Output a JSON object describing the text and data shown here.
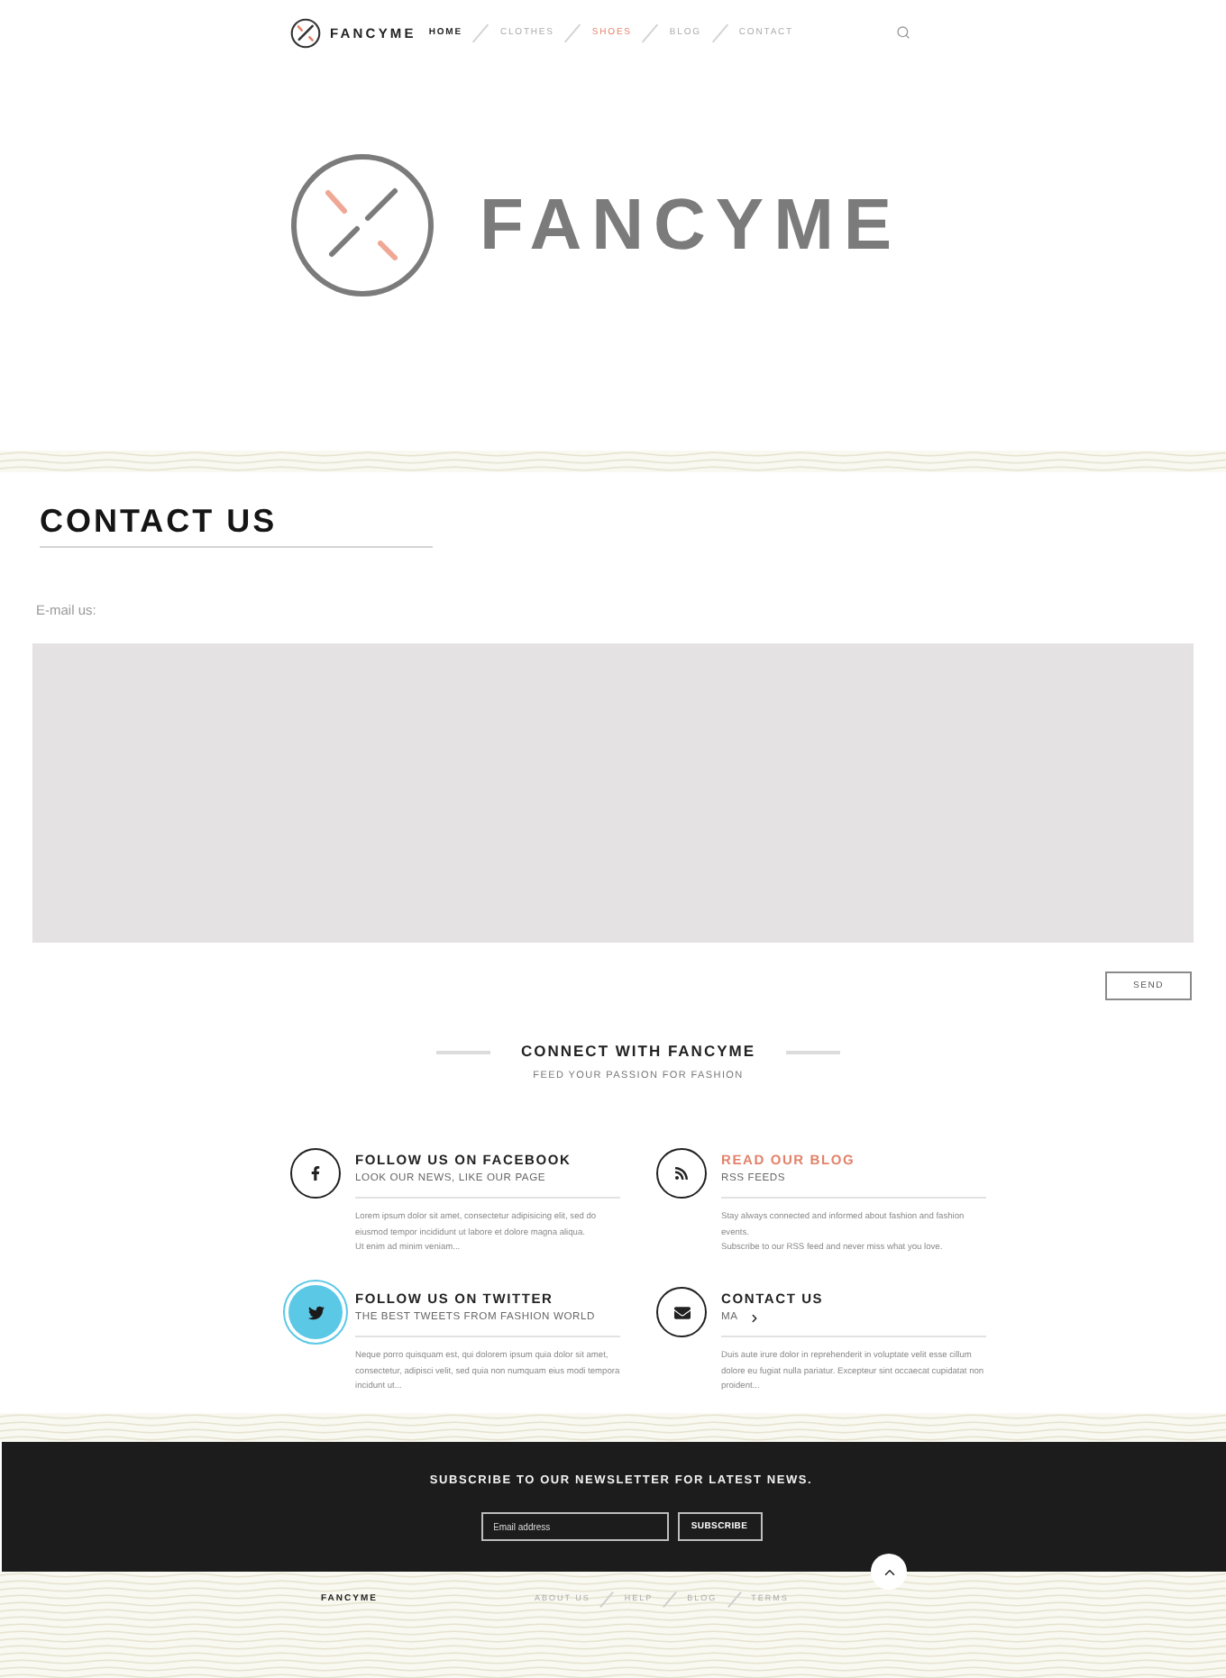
{
  "nav": {
    "brand": "FANCYME",
    "items": [
      {
        "label": "HOME",
        "selected": true,
        "highlighted": false
      },
      {
        "label": "CLOTHES",
        "selected": false,
        "highlighted": false
      },
      {
        "label": "SHOES",
        "selected": false,
        "highlighted": true
      },
      {
        "label": "BLOG",
        "selected": false,
        "highlighted": false
      },
      {
        "label": "CONTACT",
        "selected": false,
        "highlighted": false
      }
    ]
  },
  "hero": {
    "logo_text": "FANCYME"
  },
  "contact": {
    "title": "CONTACT US",
    "email_label": "E-mail us:",
    "send_button": "SEND"
  },
  "connect": {
    "title": "CONNECT WITH FANCYME",
    "subtitle": "FEED YOUR PASSION FOR FASHION",
    "cards": [
      {
        "kind": "facebook",
        "title": "FOLLOW US ON FACEBOOK",
        "subtitle": "LOOK OUR NEWS, LIKE OUR PAGE",
        "body": [
          "Lorem ipsum dolor sit amet, consectetur adipisicing elit, sed do eiusmod tempor incididunt ut labore et dolore magna aliqua.",
          "Ut enim ad minim veniam..."
        ],
        "title_highlighted": false,
        "icon_filled": false,
        "show_chevron": false
      },
      {
        "kind": "rss",
        "title": "READ OUR BLOG",
        "subtitle": "RSS FEEDS",
        "body": [
          "Stay always connected and informed about fashion and fashion events.",
          "Subscribe to our RSS feed and never miss what you love."
        ],
        "title_highlighted": true,
        "icon_filled": false,
        "show_chevron": false
      },
      {
        "kind": "twitter",
        "title": "FOLLOW US ON TWITTER",
        "subtitle": "THE BEST TWEETS FROM FASHION WORLD",
        "body": [
          "Neque porro quisquam est, qui dolorem ipsum quia dolor sit amet, consectetur, adipisci velit, sed quia non numquam eius modi tempora incidunt ut..."
        ],
        "title_highlighted": false,
        "icon_filled": true,
        "show_chevron": false
      },
      {
        "kind": "mail",
        "title": "CONTACT US",
        "subtitle": "MA",
        "body": [
          "Duis aute irure dolor in reprehenderit in voluptate velit esse cillum dolore eu fugiat nulla pariatur. Excepteur sint occaecat cupidatat non proident..."
        ],
        "title_highlighted": false,
        "icon_filled": false,
        "show_chevron": true
      }
    ]
  },
  "newsletter": {
    "title": "SUBSCRIBE TO OUR NEWSLETTER FOR LATEST NEWS.",
    "placeholder": "Email address",
    "button": "SUBSCRIBE"
  },
  "footer": {
    "brand": "FANCYME",
    "links": [
      "ABOUT US",
      "HELP",
      "BLOG",
      "TERMS"
    ]
  }
}
